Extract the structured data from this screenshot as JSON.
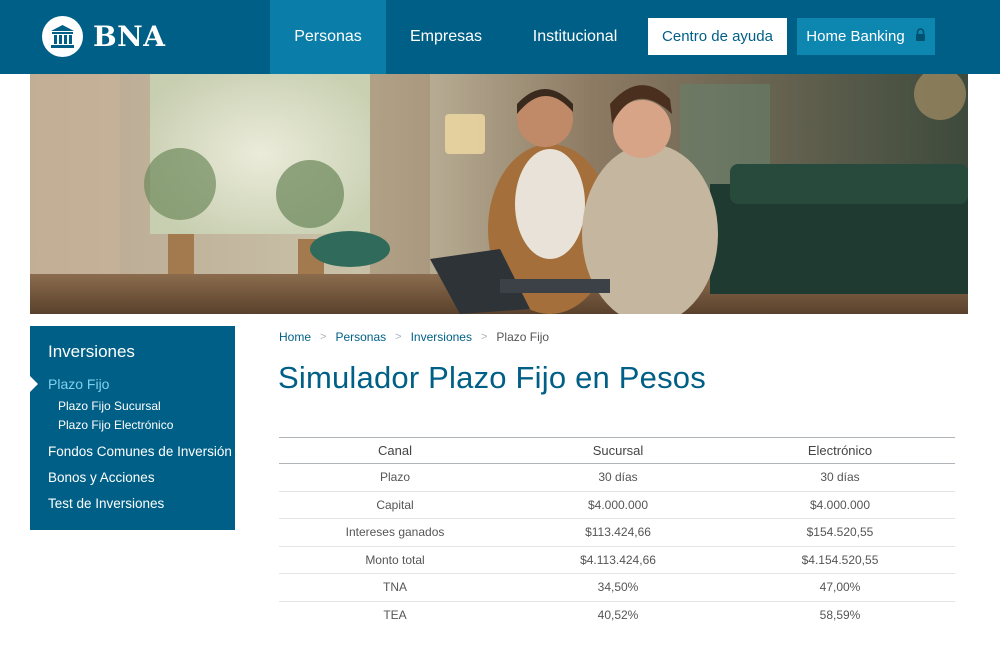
{
  "brand": {
    "logo_text": "BNA",
    "primary_color": "#005f86",
    "accent_color": "#0a7ea8",
    "link_color": "#005f86"
  },
  "nav": {
    "items": [
      {
        "label": "Personas",
        "active": true
      },
      {
        "label": "Empresas",
        "active": false
      },
      {
        "label": "Institucional",
        "active": false
      }
    ],
    "help_button": "Centro de ayuda",
    "home_banking_button": "Home Banking",
    "home_banking_icon": "lock-icon"
  },
  "sidebar": {
    "title": "Inversiones",
    "items": [
      {
        "label": "Plazo Fijo",
        "active": true
      },
      {
        "label": "Plazo Fijo Sucursal"
      },
      {
        "label": "Plazo Fijo Electrónico"
      },
      {
        "label": "Fondos Comunes de Inversión"
      },
      {
        "label": "Bonos y Acciones"
      },
      {
        "label": "Test de Inversiones"
      }
    ]
  },
  "breadcrumb": {
    "items": [
      "Home",
      "Personas",
      "Inversiones",
      "Plazo Fijo"
    ],
    "separator": ">"
  },
  "page_title": "Simulador Plazo Fijo en Pesos",
  "table": {
    "headers": [
      "Canal",
      "Sucursal",
      "Electrónico"
    ],
    "rows": [
      [
        "Plazo",
        "30 días",
        "30 días"
      ],
      [
        "Capital",
        "$4.000.000",
        "$4.000.000"
      ],
      [
        "Intereses ganados",
        "$113.424,66",
        "$154.520,55"
      ],
      [
        "Monto total",
        "$4.113.424,66",
        "$4.154.520,55"
      ],
      [
        "TNA",
        "34,50%",
        "47,00%"
      ],
      [
        "TEA",
        "40,52%",
        "58,59%"
      ]
    ]
  }
}
